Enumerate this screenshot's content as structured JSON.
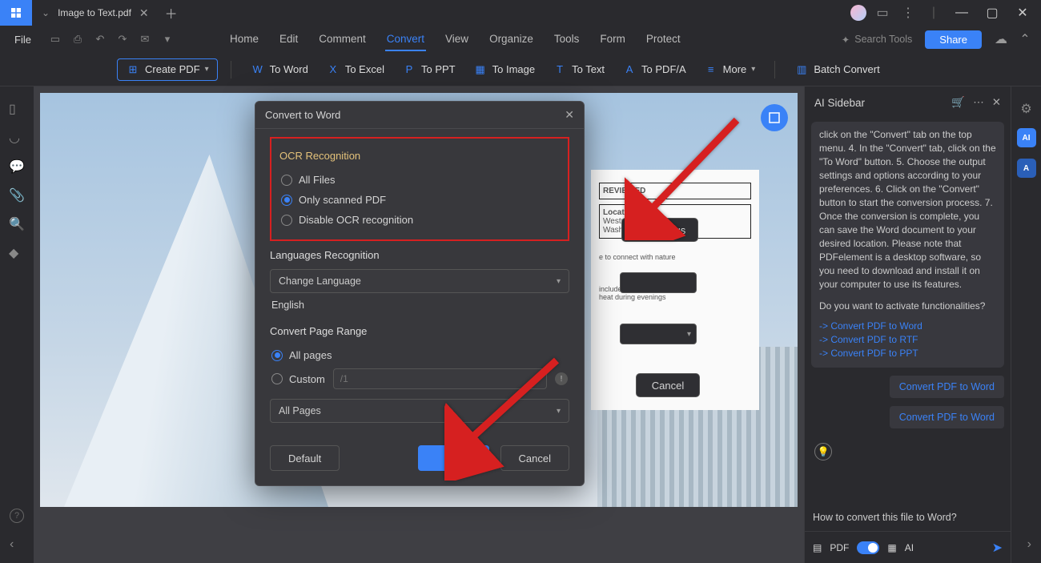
{
  "titlebar": {
    "tab_title": "Image to Text.pdf"
  },
  "menu": {
    "file": "File",
    "tabs": [
      "Home",
      "Edit",
      "Comment",
      "Convert",
      "View",
      "Organize",
      "Tools",
      "Form",
      "Protect"
    ],
    "active": "Convert",
    "search_placeholder": "Search Tools",
    "share": "Share"
  },
  "ribbon": {
    "create": "Create PDF",
    "toword": "To Word",
    "toexcel": "To Excel",
    "toppt": "To PPT",
    "toimage": "To Image",
    "totext": "To Text",
    "topdfa": "To PDF/A",
    "more": "More",
    "batch": "Batch Convert"
  },
  "behind": {
    "settings": "Settings",
    "cancel": "Cancel"
  },
  "dialog": {
    "title": "Convert to Word",
    "ocr_title": "OCR Recognition",
    "ocr_all": "All Files",
    "ocr_scanned": "Only scanned PDF",
    "ocr_disable": "Disable OCR recognition",
    "lang_title": "Languages Recognition",
    "lang_select": "Change Language",
    "lang_value": "English",
    "range_title": "Convert Page Range",
    "range_all": "All pages",
    "range_custom": "Custom",
    "range_input": "/1",
    "range_select": "All Pages",
    "default": "Default",
    "ok": "OK",
    "cancel": "Cancel"
  },
  "ai": {
    "title": "AI Sidebar",
    "text": "click on the \"Convert\" tab on the top menu. 4. In the \"Convert\" tab, click on the \"To Word\" button. 5. Choose the output settings and options according to your preferences. 6. Click on the \"Convert\" button to start the conversion process. 7. Once the conversion is complete, you can save the Word document to your desired location. Please note that PDFelement is a desktop software, so you need to download and install it on your computer to use its features.",
    "question": "Do you want to activate functionalities?",
    "link1": "-> Convert PDF to Word",
    "link2": "-> Convert PDF to RTF",
    "link3": "-> Convert PDF to PPT",
    "action": "Convert PDF to Word",
    "prompt": "How to convert this file to Word?",
    "mode_pdf": "PDF",
    "mode_ai": "AI"
  },
  "doc": {
    "reviewed": "REVIEWED",
    "loc_title": "Location",
    "loc1": "Westport,",
    "loc2": "Washington, USA",
    "line1": "e to connect with nature",
    "line2": "includes glazed areas",
    "line3": "heat during evenings"
  }
}
